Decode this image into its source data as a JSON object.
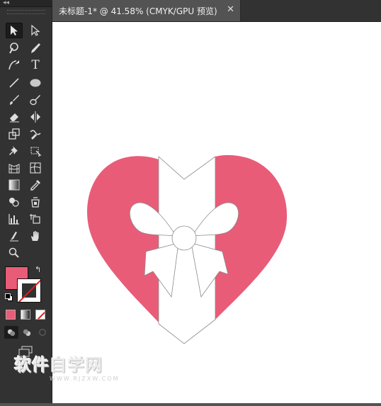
{
  "document": {
    "tab_title": "未标题-1* @ 41.58% (CMYK/GPU 预览)",
    "close_glyph": "✕"
  },
  "toolbar": {
    "collapse_glyph": "◂◂",
    "tools": [
      {
        "name": "selection-tool",
        "icon": "selection-arrow-icon",
        "active": true
      },
      {
        "name": "direct-selection-tool",
        "icon": "direct-selection-arrow-icon"
      },
      {
        "name": "magic-wand-tool",
        "icon": "magic-wand-icon"
      },
      {
        "name": "pen-tool",
        "icon": "pen-icon"
      },
      {
        "name": "curvature-tool",
        "icon": "curvature-icon"
      },
      {
        "name": "type-tool",
        "icon": "type-icon",
        "glyph": "T"
      },
      {
        "name": "line-segment-tool",
        "icon": "line-icon"
      },
      {
        "name": "ellipse-tool",
        "icon": "ellipse-icon"
      },
      {
        "name": "paintbrush-tool",
        "icon": "paintbrush-icon"
      },
      {
        "name": "blob-brush-tool",
        "icon": "blob-brush-icon"
      },
      {
        "name": "eraser-tool",
        "icon": "eraser-icon"
      },
      {
        "name": "reflect-tool",
        "icon": "reflect-icon"
      },
      {
        "name": "scale-tool",
        "icon": "scale-icon"
      },
      {
        "name": "warp-tool",
        "icon": "warp-icon"
      },
      {
        "name": "puppet-warp-tool",
        "icon": "pin-icon"
      },
      {
        "name": "free-transform-tool",
        "icon": "free-transform-icon"
      },
      {
        "name": "perspective-grid-tool",
        "icon": "perspective-grid-icon"
      },
      {
        "name": "mesh-tool",
        "icon": "mesh-icon"
      },
      {
        "name": "gradient-tool",
        "icon": "gradient-icon"
      },
      {
        "name": "eyedropper-tool",
        "icon": "eyedropper-icon"
      },
      {
        "name": "shape-builder-tool",
        "icon": "shape-builder-icon"
      },
      {
        "name": "live-paint-tool",
        "icon": "live-paint-icon"
      },
      {
        "name": "column-graph-tool",
        "icon": "column-graph-icon"
      },
      {
        "name": "artboard-tool",
        "icon": "artboard-icon"
      },
      {
        "name": "slice-tool",
        "icon": "slice-icon"
      },
      {
        "name": "hand-tool",
        "icon": "hand-icon"
      },
      {
        "name": "zoom-tool",
        "icon": "zoom-icon"
      }
    ]
  },
  "colors": {
    "fill": "#e95c78",
    "stroke": "#ffffff",
    "no_color": "#e11d1d",
    "ribbon_stroke": "#888888"
  },
  "watermark": {
    "title": "软件自学网",
    "url": "WWW.RJZXW.COM"
  }
}
